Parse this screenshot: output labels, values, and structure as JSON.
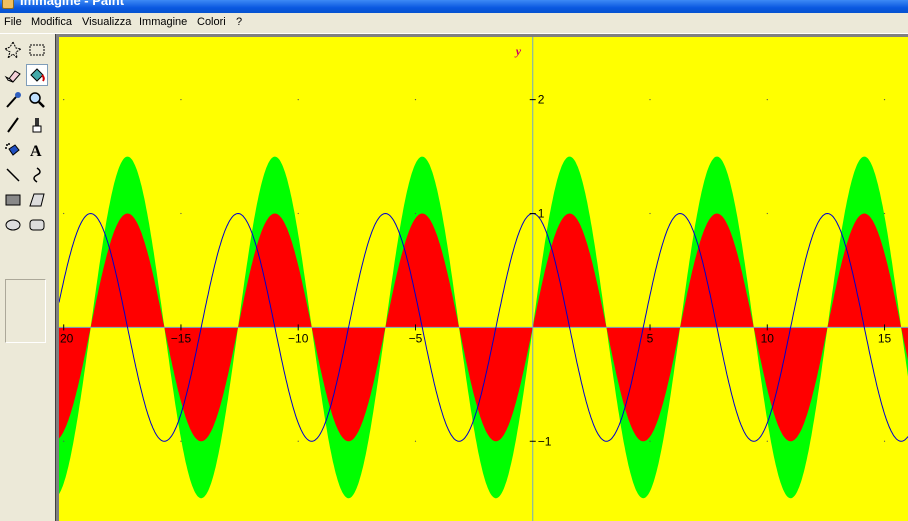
{
  "window": {
    "title": "Immagine - Paint"
  },
  "menu": [
    "File",
    "Modifica",
    "Visualizza",
    "Immagine",
    "Colori",
    "?"
  ],
  "tools": [
    "free-form-select",
    "rect-select",
    "eraser",
    "fill-with-color",
    "pick-color",
    "magnifier",
    "pencil",
    "brush",
    "airbrush",
    "text",
    "line",
    "curve",
    "rectangle",
    "polygon",
    "ellipse",
    "rounded-rectangle"
  ],
  "colors": {
    "canvas_bg": "#ffff00",
    "green_fill": "#00ff00",
    "red_fill": "#ff0000",
    "axis": "#6fa8c8",
    "cos_curve": "#0000cc",
    "y_label": "#cc0066",
    "tick_text": "#000000"
  },
  "chart_data": {
    "type": "area",
    "xlim": [
      -20.2,
      16.0
    ],
    "ylim": [
      -1.7,
      2.55
    ],
    "x_axis_label": "",
    "y_axis_label": "y",
    "x_tick_labels": [
      "20",
      "−15",
      "−10",
      "−5",
      "5",
      "10",
      "15"
    ],
    "x_tick_values": [
      -20,
      -15,
      -10,
      -5,
      5,
      10,
      15
    ],
    "y_tick_labels": [
      "2",
      "1",
      "−1"
    ],
    "y_tick_values": [
      2,
      1,
      -1
    ],
    "series": [
      {
        "name": "",
        "kind": "filled-area",
        "function": "1.5*sin(x)",
        "color": "#00ff00"
      },
      {
        "name": "",
        "kind": "filled-area",
        "function": "sin(x)",
        "color": "#ff0000"
      },
      {
        "name": "",
        "kind": "line",
        "function": "cos(x)",
        "color": "#0000cc"
      }
    ]
  }
}
